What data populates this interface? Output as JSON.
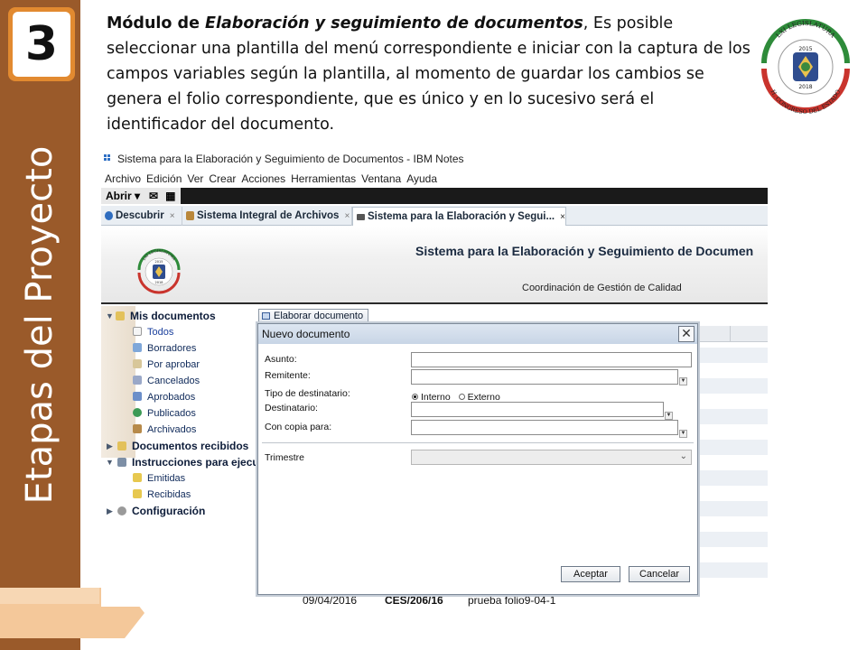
{
  "slide": {
    "step_number": "3",
    "vertical_title": "Etapas  del Proyecto",
    "description": {
      "bold_prefix": "Módulo de ",
      "bold_italic": "Elaboración y seguimiento de documentos",
      "rest": ", Es posible seleccionar una plantilla del menú correspondiente e iniciar con la captura de los campos variables según la plantilla, al momento de guardar los cambios se genera el folio correspondiente, que es único y en lo sucesivo será el identificador del documento."
    },
    "seal": {
      "top_text": "LXI LEGISLATURA",
      "year_top": "2015",
      "year_bottom": "2018",
      "bottom_text": "H. CONGRESO DEL ESTADO"
    }
  },
  "app": {
    "window_title": "Sistema para la Elaboración y Seguimiento de Documentos - IBM Notes",
    "menu": [
      "Archivo",
      "Edición",
      "Ver",
      "Crear",
      "Acciones",
      "Herramientas",
      "Ventana",
      "Ayuda"
    ],
    "toolbar": {
      "open_label": "Abrir ▾",
      "mail_icon": "✉",
      "calendar_icon": "▦"
    },
    "tabs": [
      {
        "label": "Descubrir",
        "icon": "info-icon"
      },
      {
        "label": "Sistema Integral de Archivos",
        "icon": "archive-icon"
      },
      {
        "label": "Sistema para la Elaboración y Segui...",
        "icon": "document-icon"
      }
    ],
    "tab_close": "×",
    "banner": {
      "title": "Sistema para la Elaboración y Seguimiento de Documen",
      "subtitle": "Coordinación de Gestión de Calidad",
      "seal_top_text": "LXI LEGISLATURA",
      "seal_year_top": "2015",
      "seal_year_bottom": "2018"
    },
    "nav": {
      "mis_documentos": "Mis documentos",
      "todos": "Todos",
      "borradores": "Borradores",
      "por_aprobar": "Por aprobar",
      "cancelados": "Cancelados",
      "aprobados": "Aprobados",
      "publicados": "Publicados",
      "archivados": "Archivados",
      "documentos_recibidos": "Documentos recibidos",
      "instrucciones": "Instrucciones para ejecu",
      "emitidas": "Emitidas",
      "recibidas": "Recibidas",
      "configuracion": "Configuración"
    },
    "elaborar_button": "Elaborar documento",
    "last_row": {
      "date": "09/04/2016",
      "folio": "CES/206/16",
      "subject": "prueba folio9-04-1"
    },
    "dialog": {
      "title": "Nuevo documento",
      "close": "✕",
      "asunto_label": "Asunto:",
      "remitente_label": "Remitente:",
      "tipo_label": "Tipo de destinatario:",
      "radio_interno": "Interno",
      "radio_externo": "Externo",
      "radio_selected": "Interno",
      "destinatario_label": "Destinatario:",
      "copia_label": "Con copia para:",
      "trimestre_label": "Trimestre",
      "trimestre_value": "",
      "accept": "Aceptar",
      "cancel": "Cancelar"
    }
  }
}
